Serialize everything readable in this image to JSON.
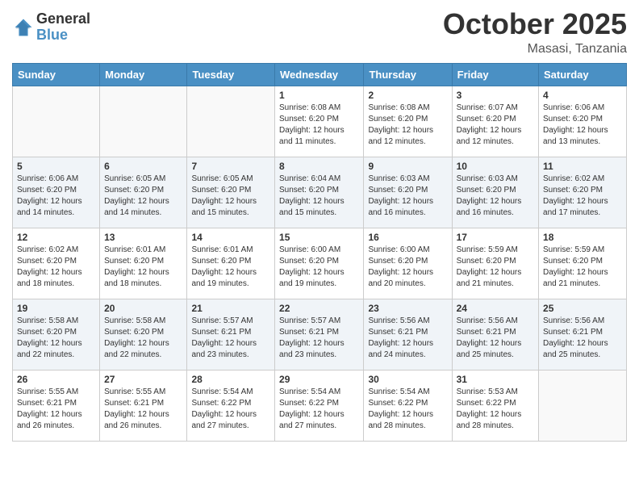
{
  "header": {
    "logo_line1": "General",
    "logo_line2": "Blue",
    "month": "October 2025",
    "location": "Masasi, Tanzania"
  },
  "weekdays": [
    "Sunday",
    "Monday",
    "Tuesday",
    "Wednesday",
    "Thursday",
    "Friday",
    "Saturday"
  ],
  "weeks": [
    [
      {
        "day": "",
        "info": ""
      },
      {
        "day": "",
        "info": ""
      },
      {
        "day": "",
        "info": ""
      },
      {
        "day": "1",
        "info": "Sunrise: 6:08 AM\nSunset: 6:20 PM\nDaylight: 12 hours\nand 11 minutes."
      },
      {
        "day": "2",
        "info": "Sunrise: 6:08 AM\nSunset: 6:20 PM\nDaylight: 12 hours\nand 12 minutes."
      },
      {
        "day": "3",
        "info": "Sunrise: 6:07 AM\nSunset: 6:20 PM\nDaylight: 12 hours\nand 12 minutes."
      },
      {
        "day": "4",
        "info": "Sunrise: 6:06 AM\nSunset: 6:20 PM\nDaylight: 12 hours\nand 13 minutes."
      }
    ],
    [
      {
        "day": "5",
        "info": "Sunrise: 6:06 AM\nSunset: 6:20 PM\nDaylight: 12 hours\nand 14 minutes."
      },
      {
        "day": "6",
        "info": "Sunrise: 6:05 AM\nSunset: 6:20 PM\nDaylight: 12 hours\nand 14 minutes."
      },
      {
        "day": "7",
        "info": "Sunrise: 6:05 AM\nSunset: 6:20 PM\nDaylight: 12 hours\nand 15 minutes."
      },
      {
        "day": "8",
        "info": "Sunrise: 6:04 AM\nSunset: 6:20 PM\nDaylight: 12 hours\nand 15 minutes."
      },
      {
        "day": "9",
        "info": "Sunrise: 6:03 AM\nSunset: 6:20 PM\nDaylight: 12 hours\nand 16 minutes."
      },
      {
        "day": "10",
        "info": "Sunrise: 6:03 AM\nSunset: 6:20 PM\nDaylight: 12 hours\nand 16 minutes."
      },
      {
        "day": "11",
        "info": "Sunrise: 6:02 AM\nSunset: 6:20 PM\nDaylight: 12 hours\nand 17 minutes."
      }
    ],
    [
      {
        "day": "12",
        "info": "Sunrise: 6:02 AM\nSunset: 6:20 PM\nDaylight: 12 hours\nand 18 minutes."
      },
      {
        "day": "13",
        "info": "Sunrise: 6:01 AM\nSunset: 6:20 PM\nDaylight: 12 hours\nand 18 minutes."
      },
      {
        "day": "14",
        "info": "Sunrise: 6:01 AM\nSunset: 6:20 PM\nDaylight: 12 hours\nand 19 minutes."
      },
      {
        "day": "15",
        "info": "Sunrise: 6:00 AM\nSunset: 6:20 PM\nDaylight: 12 hours\nand 19 minutes."
      },
      {
        "day": "16",
        "info": "Sunrise: 6:00 AM\nSunset: 6:20 PM\nDaylight: 12 hours\nand 20 minutes."
      },
      {
        "day": "17",
        "info": "Sunrise: 5:59 AM\nSunset: 6:20 PM\nDaylight: 12 hours\nand 21 minutes."
      },
      {
        "day": "18",
        "info": "Sunrise: 5:59 AM\nSunset: 6:20 PM\nDaylight: 12 hours\nand 21 minutes."
      }
    ],
    [
      {
        "day": "19",
        "info": "Sunrise: 5:58 AM\nSunset: 6:20 PM\nDaylight: 12 hours\nand 22 minutes."
      },
      {
        "day": "20",
        "info": "Sunrise: 5:58 AM\nSunset: 6:20 PM\nDaylight: 12 hours\nand 22 minutes."
      },
      {
        "day": "21",
        "info": "Sunrise: 5:57 AM\nSunset: 6:21 PM\nDaylight: 12 hours\nand 23 minutes."
      },
      {
        "day": "22",
        "info": "Sunrise: 5:57 AM\nSunset: 6:21 PM\nDaylight: 12 hours\nand 23 minutes."
      },
      {
        "day": "23",
        "info": "Sunrise: 5:56 AM\nSunset: 6:21 PM\nDaylight: 12 hours\nand 24 minutes."
      },
      {
        "day": "24",
        "info": "Sunrise: 5:56 AM\nSunset: 6:21 PM\nDaylight: 12 hours\nand 25 minutes."
      },
      {
        "day": "25",
        "info": "Sunrise: 5:56 AM\nSunset: 6:21 PM\nDaylight: 12 hours\nand 25 minutes."
      }
    ],
    [
      {
        "day": "26",
        "info": "Sunrise: 5:55 AM\nSunset: 6:21 PM\nDaylight: 12 hours\nand 26 minutes."
      },
      {
        "day": "27",
        "info": "Sunrise: 5:55 AM\nSunset: 6:21 PM\nDaylight: 12 hours\nand 26 minutes."
      },
      {
        "day": "28",
        "info": "Sunrise: 5:54 AM\nSunset: 6:22 PM\nDaylight: 12 hours\nand 27 minutes."
      },
      {
        "day": "29",
        "info": "Sunrise: 5:54 AM\nSunset: 6:22 PM\nDaylight: 12 hours\nand 27 minutes."
      },
      {
        "day": "30",
        "info": "Sunrise: 5:54 AM\nSunset: 6:22 PM\nDaylight: 12 hours\nand 28 minutes."
      },
      {
        "day": "31",
        "info": "Sunrise: 5:53 AM\nSunset: 6:22 PM\nDaylight: 12 hours\nand 28 minutes."
      },
      {
        "day": "",
        "info": ""
      }
    ]
  ]
}
